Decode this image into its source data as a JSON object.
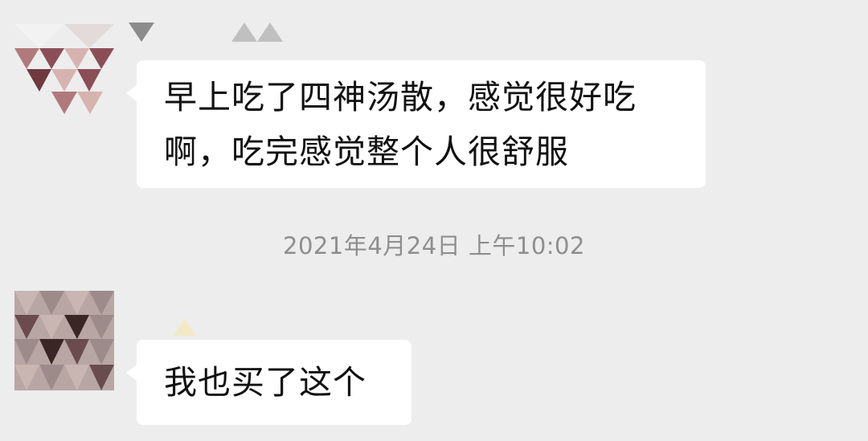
{
  "colors": {
    "background": "#ededed",
    "bubble": "#ffffff",
    "message_text": "#111111",
    "timestamp_text": "#8e8e8e",
    "avatar_1_shades": [
      "#6e3a3f",
      "#8c4e56",
      "#b07a7c",
      "#d7b3b0"
    ],
    "avatar_2_shades": [
      "#3a2624",
      "#6a4c4e",
      "#9d8a8b",
      "#c9b6b2"
    ]
  },
  "messages": [
    {
      "sender": "contact-1",
      "avatar_icon": "pixelated-avatar-icon",
      "lines": [
        "早上吃了四神汤散，感觉很好吃",
        "啊，吃完感觉整个人很舒服"
      ]
    },
    {
      "sender": "contact-2",
      "avatar_icon": "pixelated-avatar-icon",
      "lines": [
        "我也买了这个"
      ]
    }
  ],
  "timestamp": "2021年4月24日 上午10:02"
}
